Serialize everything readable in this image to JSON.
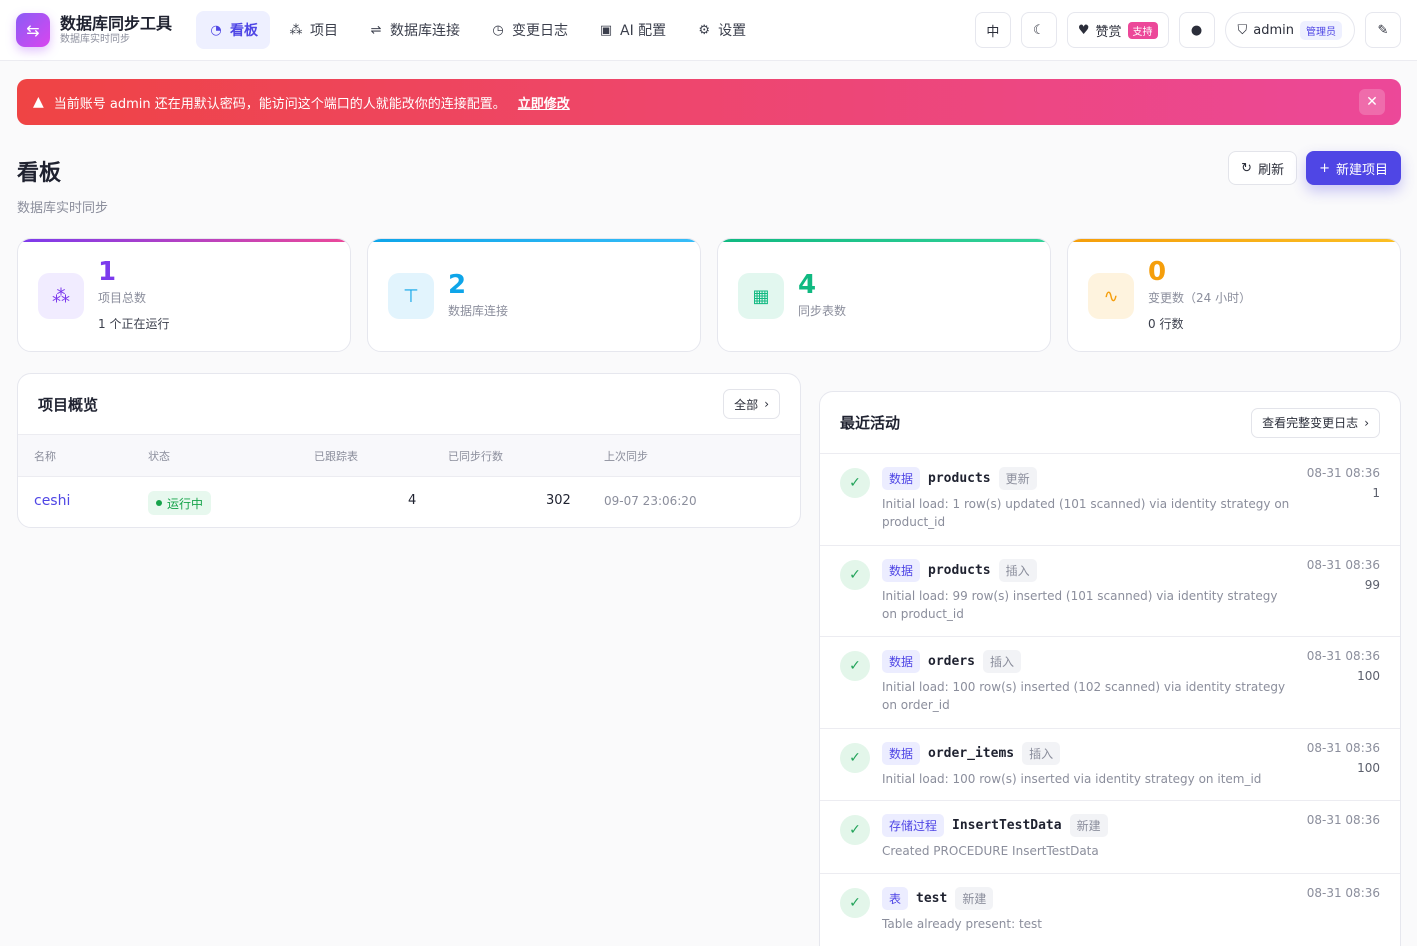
{
  "brand": {
    "title": "数据库同步工具",
    "subtitle": "数据库实时同步",
    "icon": "swap-icon"
  },
  "nav": [
    {
      "label": "看板",
      "icon": "gauge-icon",
      "active": true
    },
    {
      "label": "项目",
      "icon": "sitemap-icon",
      "active": false
    },
    {
      "label": "数据库连接",
      "icon": "connection-icon",
      "active": false
    },
    {
      "label": "变更日志",
      "icon": "clock-icon",
      "active": false
    },
    {
      "label": "AI 配置",
      "icon": "chip-icon",
      "active": false
    },
    {
      "label": "设置",
      "icon": "gear-icon",
      "active": false
    }
  ],
  "topbar": {
    "lang_label": "中",
    "sponsor_label": "赞赏",
    "sponsor_badge": "支持",
    "user_name": "admin",
    "user_role": "管理员"
  },
  "alert": {
    "message": "当前账号 admin 还在用默认密码，能访问这个端口的人就能改你的连接配置。",
    "link": "立即修改",
    "color_from": "#ef4444",
    "color_to": "#ec4899"
  },
  "page": {
    "title": "看板",
    "subtitle": "数据库实时同步",
    "refresh_label": "刷新",
    "new_project_label": "新建项目"
  },
  "stats": [
    {
      "value": "1",
      "label": "项目总数",
      "extra": "1 个正在运行",
      "color": "#7c3aed"
    },
    {
      "value": "2",
      "label": "数据库连接",
      "extra": "",
      "color": "#0ea5e9"
    },
    {
      "value": "4",
      "label": "同步表数",
      "extra": "",
      "color": "#10b981"
    },
    {
      "value": "0",
      "label": "变更数（24 小时）",
      "extra": "0 行数",
      "color": "#f59e0b"
    }
  ],
  "projects": {
    "title": "项目概览",
    "all_label": "全部",
    "columns": [
      "名称",
      "状态",
      "已跟踪表",
      "已同步行数",
      "上次同步"
    ],
    "rows": [
      {
        "name": "ceshi",
        "status": "运行中",
        "tables": "4",
        "rows": "302",
        "last_sync": "09-07 23:06:20"
      }
    ]
  },
  "activity": {
    "title": "最近活动",
    "view_all_label": "查看完整变更日志",
    "items": [
      {
        "type": "数据",
        "name": "products",
        "op": "更新",
        "desc": "Initial load: 1 row(s) updated (101 scanned) via identity strategy on product_id",
        "time": "08-31 08:36",
        "count": "1"
      },
      {
        "type": "数据",
        "name": "products",
        "op": "插入",
        "desc": "Initial load: 99 row(s) inserted (101 scanned) via identity strategy on product_id",
        "time": "08-31 08:36",
        "count": "99"
      },
      {
        "type": "数据",
        "name": "orders",
        "op": "插入",
        "desc": "Initial load: 100 row(s) inserted (102 scanned) via identity strategy on order_id",
        "time": "08-31 08:36",
        "count": "100"
      },
      {
        "type": "数据",
        "name": "order_items",
        "op": "插入",
        "desc": "Initial load: 100 row(s) inserted via identity strategy on item_id",
        "time": "08-31 08:36",
        "count": "100"
      },
      {
        "type": "存储过程",
        "name": "InsertTestData",
        "op": "新建",
        "desc": "Created PROCEDURE InsertTestData",
        "time": "08-31 08:36",
        "count": ""
      },
      {
        "type": "表",
        "name": "test",
        "op": "新建",
        "desc": "Table already present: test",
        "time": "08-31 08:36",
        "count": ""
      }
    ]
  },
  "colors": {
    "accent": "#4f46e5",
    "success": "#16a34a"
  }
}
